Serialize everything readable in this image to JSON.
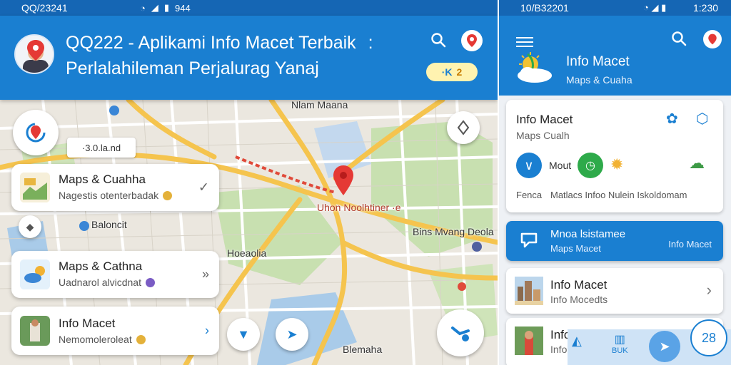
{
  "left": {
    "status": {
      "time": "QQ/23241",
      "icons_text": "944"
    },
    "appbar": {
      "title": "QQ222 - Aplikami Info Macet Terbaik",
      "title_menu": ":",
      "subtitle": "Perlalahileman Perjalurag Yanaj",
      "pill_left": "·K",
      "pill_right": "2"
    },
    "map_labels": {
      "top": "Nlam Maana",
      "center": "Uhon Noolhtiner ·e",
      "right": "Bins Mvang Deola",
      "mid": "Baloncit",
      "lower": "Hoeaolia",
      "bottom": "Blemaha"
    },
    "tooltip": "·3.0.la.nd",
    "cards": [
      {
        "title": "Maps & Cuahha",
        "subtitle": "Nagestis otenterbadak",
        "chevron": "✓",
        "badge_color": "#e4b13a"
      },
      {
        "title": "Maps & Cathna",
        "subtitle": "Uadnarol alvicdnat",
        "chevron": "»",
        "badge_color": "#7a5cc4"
      },
      {
        "title": "Info Macet",
        "subtitle": "Nemomoleroleat",
        "chevron": "›",
        "badge_color": "#e4b13a"
      }
    ]
  },
  "right": {
    "status": {
      "time": "10/B32201",
      "clock": "1:230"
    },
    "appbar": {
      "title": "Info Macet",
      "subtitle": "Maps & Cuaha"
    },
    "info_card": {
      "title": "Info Macet",
      "subtitle": "Maps Cualh",
      "action_label": "Mout",
      "footer_left": "Fenca",
      "footer_right": "Matlacs Infoo Nulein Iskoldomam"
    },
    "blue_card": {
      "title": "Mnoa lsistamee",
      "subtitle": "Maps Macet",
      "right_label": "Info Macet"
    },
    "list": [
      {
        "title": "Info Macet",
        "subtitle": "Info Mocedts",
        "chevron": "›"
      },
      {
        "title": "Info Macet",
        "subtitle": "Info Macrs"
      }
    ],
    "bottom_nav": {
      "item2": "BUK",
      "fab_label": "28"
    }
  },
  "colors": {
    "primary": "#1a7fd1",
    "status": "#1566b4",
    "accent_green": "#2eaa4a",
    "road": "#f5c44e"
  }
}
